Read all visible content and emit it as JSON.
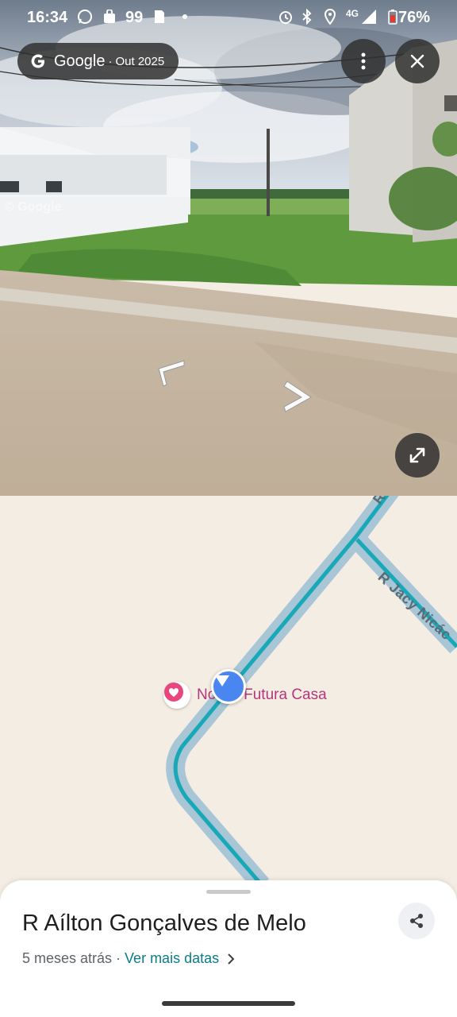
{
  "status_bar": {
    "time": "16:34",
    "notification_text": "99",
    "network": "4G",
    "battery": "76%"
  },
  "street_view": {
    "brand": "Google",
    "date_separator": "·",
    "date": "Out 2025",
    "watermark": "© Google",
    "icons": {
      "more": "more-vert-icon",
      "close": "close-icon",
      "expand": "expand-icon",
      "nav_left": "nav-arrow-left-icon",
      "nav_right": "nav-arrow-right-icon"
    }
  },
  "map": {
    "street_label_top": "R G",
    "street_label_right": "R Jacy Nicác",
    "place_name": "Nossa Futura Casa",
    "colors": {
      "road": "#a8c6d6",
      "route": "#19a8b8",
      "background": "#f4ede3",
      "place_pin": "#e8467c",
      "user_marker": "#4a86f0"
    }
  },
  "bottom_sheet": {
    "title": "R Aílton Gonçalves de Melo",
    "age": "5 meses atrás",
    "separator": "·",
    "more_dates_link": "Ver mais datas"
  }
}
